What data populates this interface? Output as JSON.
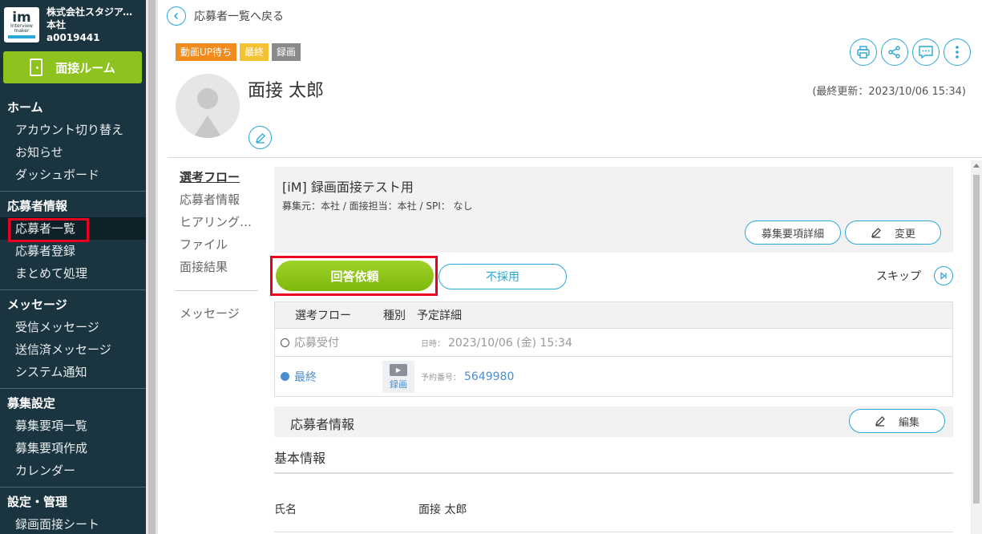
{
  "sidebar": {
    "logo": {
      "im": "im",
      "sub1": "Interview",
      "sub2": "maker"
    },
    "company_name": "株式会社スタジアム…",
    "branch": "本社",
    "account_id": "a0019441",
    "room_button": "面接ルーム",
    "sections": {
      "home": {
        "title": "ホーム",
        "items": [
          "アカウント切り替え",
          "お知らせ",
          "ダッシュボード"
        ]
      },
      "applicants": {
        "title": "応募者情報",
        "items": [
          "応募者一覧",
          "応募者登録",
          "まとめて処理"
        ]
      },
      "messages": {
        "title": "メッセージ",
        "items": [
          "受信メッセージ",
          "送信済メッセージ",
          "システム通知"
        ]
      },
      "recruit": {
        "title": "募集設定",
        "items": [
          "募集要項一覧",
          "募集要項作成",
          "カレンダー"
        ]
      },
      "settings": {
        "title": "設定・管理",
        "items": [
          "録画面接シート"
        ]
      }
    }
  },
  "header": {
    "back_label": "応募者一覧へ戻る",
    "badges": [
      {
        "label": "動画UP待ち",
        "color": "#f08c1e"
      },
      {
        "label": "最終",
        "color": "#f3c232"
      },
      {
        "label": "録画",
        "color": "#8a8a8a"
      }
    ],
    "name": "面接 太郎",
    "last_updated": "(最終更新：2023/10/06 15:34)",
    "icons": [
      "print-icon",
      "share-icon",
      "chat-icon",
      "more-icon"
    ]
  },
  "subnav": {
    "items": [
      "選考フロー",
      "応募者情報",
      "ヒアリング…",
      "ファイル",
      "面接結果"
    ],
    "message": "メッセージ"
  },
  "recruitment": {
    "title": "[iM] 録画面接テスト用",
    "subtitle": "募集元：本社 / 面接担当：本社 / SPI： なし",
    "detail_button": "募集要項詳細",
    "change_button": "変更"
  },
  "actions": {
    "answer_request": "回答依頼",
    "reject": "不採用",
    "skip": "スキップ"
  },
  "flow_table": {
    "headers": [
      "選考フロー",
      "種別",
      "予定詳細"
    ],
    "rows": [
      {
        "step": "応募受付",
        "type": "",
        "detail_label": "日時：",
        "detail_value": "2023/10/06 (金) 15:34"
      },
      {
        "step": "最終",
        "type": "録画",
        "detail_label": "予約番号：",
        "detail_value": "5649980"
      }
    ]
  },
  "applicant_info": {
    "title": "応募者情報",
    "edit_button": "編集",
    "basic_title": "基本情報",
    "fields": [
      {
        "label": "氏名",
        "value": "面接 太郎"
      }
    ]
  },
  "colors": {
    "accent": "#2aa7d6",
    "green": "#8dc21f",
    "sidebar": "#1b3540",
    "highlight": "#e8001e"
  }
}
